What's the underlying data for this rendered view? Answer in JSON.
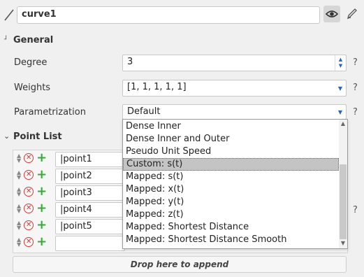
{
  "header": {
    "curve_name": "curve1",
    "icons": [
      "pencil-icon",
      "eye-icon",
      "edit-icon"
    ]
  },
  "general": {
    "title": "General",
    "degree_label": "Degree",
    "degree_value": "3",
    "weights_label": "Weights",
    "weights_value": "[1, 1, 1, 1, 1]",
    "param_label": "Parametrization",
    "param_value": "Default",
    "help": "?"
  },
  "point_list": {
    "title": "Point List",
    "points": [
      "point1",
      "point2",
      "point3",
      "point4",
      "point5"
    ],
    "append_label": "Drop here to append"
  },
  "dropdown": {
    "options": [
      "Dense Inner",
      "Dense Inner and Outer",
      "Pseudo Unit Speed",
      "Custom: s(t)",
      "Mapped: s(t)",
      "Mapped: x(t)",
      "Mapped: y(t)",
      "Mapped: z(t)",
      "Mapped: Shortest Distance",
      "Mapped: Shortest Distance Smooth"
    ],
    "highlighted": "Custom: s(t)"
  },
  "colors": {
    "accent": "#2a64b8",
    "remove": "#d23b3b",
    "add": "#3aa83a",
    "highlight": "#c4c4c4"
  }
}
